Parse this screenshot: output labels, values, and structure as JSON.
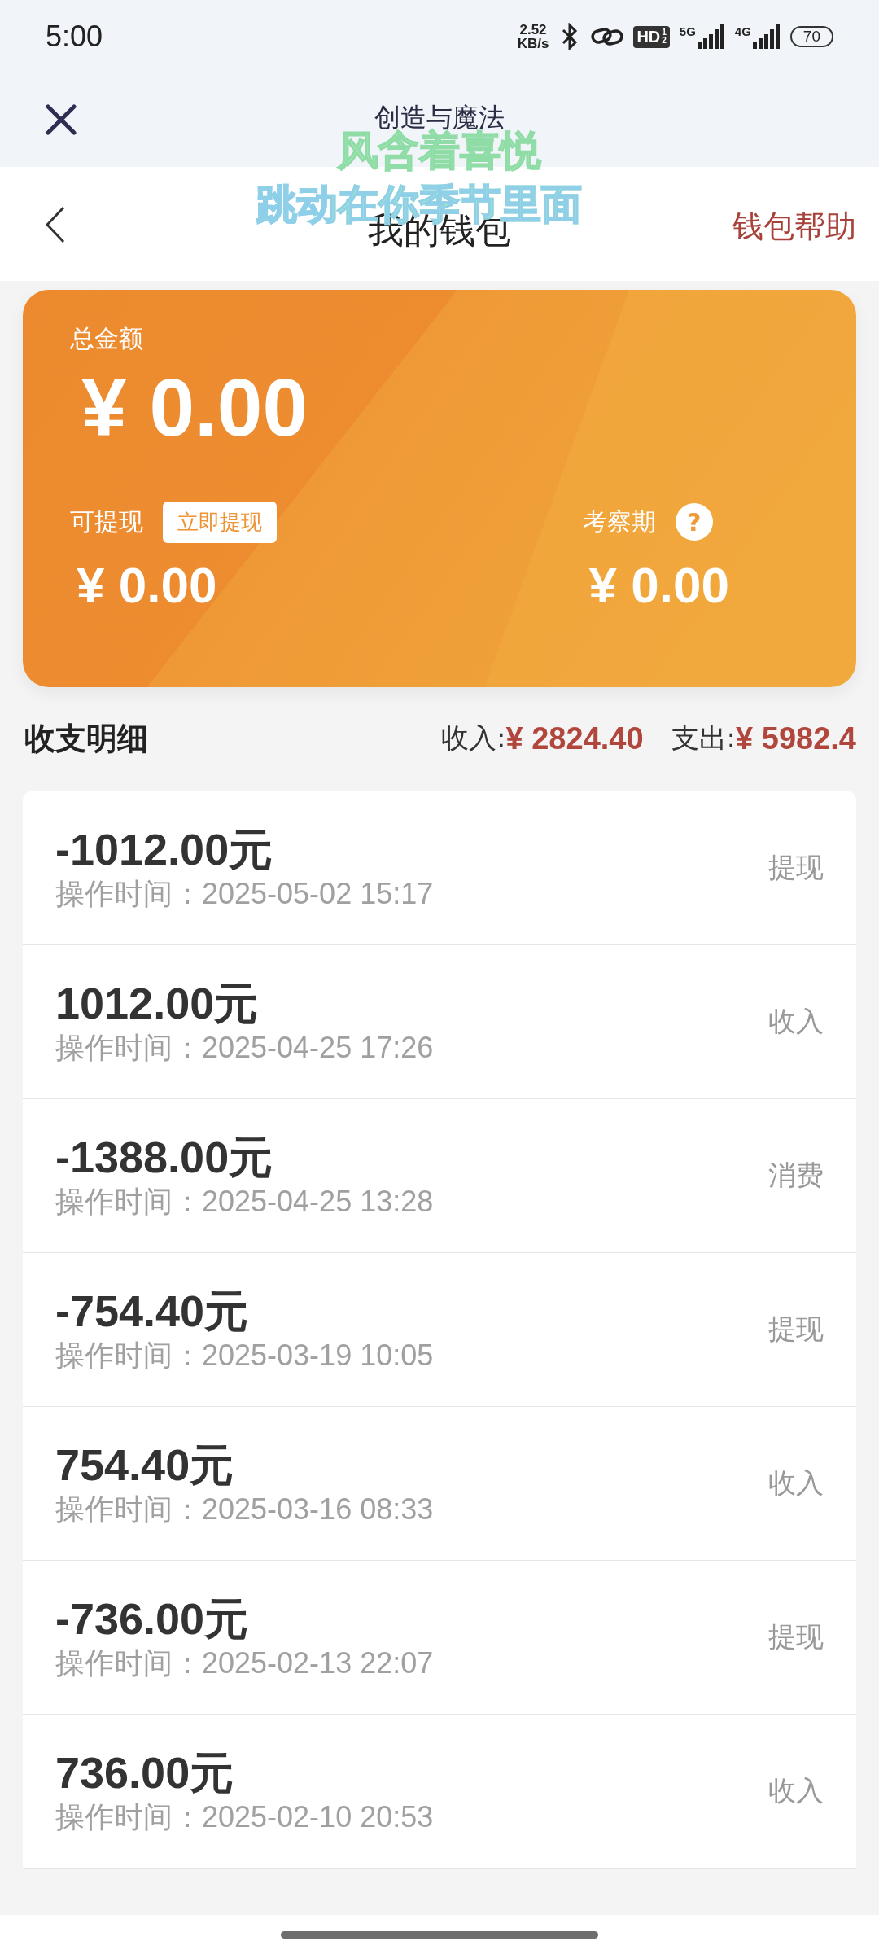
{
  "status_bar": {
    "time": "5:00",
    "net_speed": [
      "2.52",
      "KB/s"
    ],
    "hd": "HD",
    "hd_sub": "1",
    "hd_sub2": "2",
    "sig1": "5G",
    "sig2": "4G",
    "battery": "70"
  },
  "mini_bar": {
    "title": "创造与魔法"
  },
  "header": {
    "title": "我的钱包",
    "action": "钱包帮助"
  },
  "lyrics": {
    "lines": [
      "风含着喜悦",
      "跳动在你季节里面"
    ]
  },
  "card": {
    "total_label": "总金额",
    "total": "¥ 0.00",
    "withdrawable_label": "可提现",
    "withdraw_button": "立即提现",
    "withdrawable": "¥ 0.00",
    "review_label": "考察期",
    "help_icon": "?",
    "review": "¥ 0.00"
  },
  "summary": {
    "title": "收支明细",
    "income_label": "收入:",
    "income": "¥ 2824.40",
    "expense_label": "支出:",
    "expense": "¥ 5982.4"
  },
  "transactions": [
    {
      "amount": "-1012.00元",
      "time": "操作时间：2025-05-02 15:17",
      "type": "提现"
    },
    {
      "amount": "1012.00元",
      "time": "操作时间：2025-04-25 17:26",
      "type": "收入"
    },
    {
      "amount": "-1388.00元",
      "time": "操作时间：2025-04-25 13:28",
      "type": "消费"
    },
    {
      "amount": "-754.40元",
      "time": "操作时间：2025-03-19 10:05",
      "type": "提现"
    },
    {
      "amount": "754.40元",
      "time": "操作时间：2025-03-16 08:33",
      "type": "收入"
    },
    {
      "amount": "-736.00元",
      "time": "操作时间：2025-02-13 22:07",
      "type": "提现"
    },
    {
      "amount": "736.00元",
      "time": "操作时间：2025-02-10 20:53",
      "type": "收入"
    }
  ]
}
